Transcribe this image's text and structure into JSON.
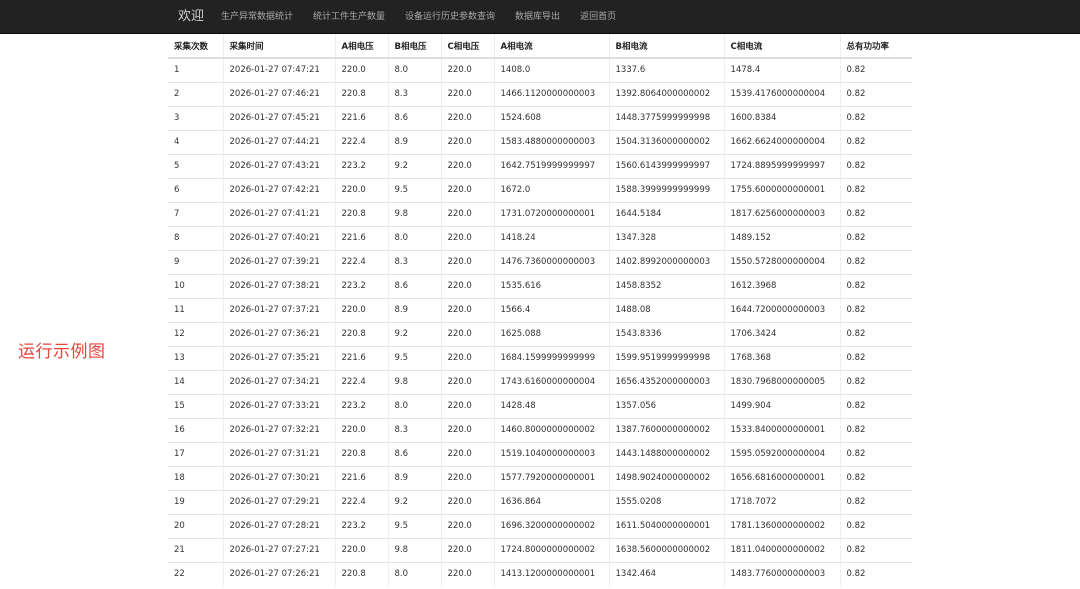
{
  "nav": {
    "brand": "欢迎",
    "links": [
      "生产异常数据统计",
      "统计工件生产数量",
      "设备运行历史参数查询",
      "数据库导出",
      "返回首页"
    ]
  },
  "side_label": "运行示例图",
  "table": {
    "headers": [
      "采集次数",
      "采集时间",
      "A相电压",
      "B相电压",
      "C相电压",
      "A相电流",
      "B相电流",
      "C相电流",
      "总有功功率"
    ],
    "rows": [
      [
        "1",
        "2026-01-27 07:47:21",
        "220.0",
        "8.0",
        "220.0",
        "1408.0",
        "1337.6",
        "1478.4",
        "0.82"
      ],
      [
        "2",
        "2026-01-27 07:46:21",
        "220.8",
        "8.3",
        "220.0",
        "1466.1120000000003",
        "1392.8064000000002",
        "1539.4176000000004",
        "0.82"
      ],
      [
        "3",
        "2026-01-27 07:45:21",
        "221.6",
        "8.6",
        "220.0",
        "1524.608",
        "1448.3775999999998",
        "1600.8384",
        "0.82"
      ],
      [
        "4",
        "2026-01-27 07:44:21",
        "222.4",
        "8.9",
        "220.0",
        "1583.4880000000003",
        "1504.3136000000002",
        "1662.6624000000004",
        "0.82"
      ],
      [
        "5",
        "2026-01-27 07:43:21",
        "223.2",
        "9.2",
        "220.0",
        "1642.7519999999997",
        "1560.6143999999997",
        "1724.8895999999997",
        "0.82"
      ],
      [
        "6",
        "2026-01-27 07:42:21",
        "220.0",
        "9.5",
        "220.0",
        "1672.0",
        "1588.3999999999999",
        "1755.6000000000001",
        "0.82"
      ],
      [
        "7",
        "2026-01-27 07:41:21",
        "220.8",
        "9.8",
        "220.0",
        "1731.0720000000001",
        "1644.5184",
        "1817.6256000000003",
        "0.82"
      ],
      [
        "8",
        "2026-01-27 07:40:21",
        "221.6",
        "8.0",
        "220.0",
        "1418.24",
        "1347.328",
        "1489.152",
        "0.82"
      ],
      [
        "9",
        "2026-01-27 07:39:21",
        "222.4",
        "8.3",
        "220.0",
        "1476.7360000000003",
        "1402.8992000000003",
        "1550.5728000000004",
        "0.82"
      ],
      [
        "10",
        "2026-01-27 07:38:21",
        "223.2",
        "8.6",
        "220.0",
        "1535.616",
        "1458.8352",
        "1612.3968",
        "0.82"
      ],
      [
        "11",
        "2026-01-27 07:37:21",
        "220.0",
        "8.9",
        "220.0",
        "1566.4",
        "1488.08",
        "1644.7200000000003",
        "0.82"
      ],
      [
        "12",
        "2026-01-27 07:36:21",
        "220.8",
        "9.2",
        "220.0",
        "1625.088",
        "1543.8336",
        "1706.3424",
        "0.82"
      ],
      [
        "13",
        "2026-01-27 07:35:21",
        "221.6",
        "9.5",
        "220.0",
        "1684.1599999999999",
        "1599.9519999999998",
        "1768.368",
        "0.82"
      ],
      [
        "14",
        "2026-01-27 07:34:21",
        "222.4",
        "9.8",
        "220.0",
        "1743.6160000000004",
        "1656.4352000000003",
        "1830.7968000000005",
        "0.82"
      ],
      [
        "15",
        "2026-01-27 07:33:21",
        "223.2",
        "8.0",
        "220.0",
        "1428.48",
        "1357.056",
        "1499.904",
        "0.82"
      ],
      [
        "16",
        "2026-01-27 07:32:21",
        "220.0",
        "8.3",
        "220.0",
        "1460.8000000000002",
        "1387.7600000000002",
        "1533.8400000000001",
        "0.82"
      ],
      [
        "17",
        "2026-01-27 07:31:21",
        "220.8",
        "8.6",
        "220.0",
        "1519.1040000000003",
        "1443.1488000000002",
        "1595.0592000000004",
        "0.82"
      ],
      [
        "18",
        "2026-01-27 07:30:21",
        "221.6",
        "8.9",
        "220.0",
        "1577.7920000000001",
        "1498.9024000000002",
        "1656.6816000000001",
        "0.82"
      ],
      [
        "19",
        "2026-01-27 07:29:21",
        "222.4",
        "9.2",
        "220.0",
        "1636.864",
        "1555.0208",
        "1718.7072",
        "0.82"
      ],
      [
        "20",
        "2026-01-27 07:28:21",
        "223.2",
        "9.5",
        "220.0",
        "1696.3200000000002",
        "1611.5040000000001",
        "1781.1360000000002",
        "0.82"
      ],
      [
        "21",
        "2026-01-27 07:27:21",
        "220.0",
        "9.8",
        "220.0",
        "1724.8000000000002",
        "1638.5600000000002",
        "1811.0400000000002",
        "0.82"
      ],
      [
        "22",
        "2026-01-27 07:26:21",
        "220.8",
        "8.0",
        "220.0",
        "1413.1200000000001",
        "1342.464",
        "1483.7760000000003",
        "0.82"
      ]
    ]
  },
  "colors": {
    "navbar_bg": "#222222",
    "nav_text": "#a9a9a9",
    "label_red": "#e8453c"
  }
}
